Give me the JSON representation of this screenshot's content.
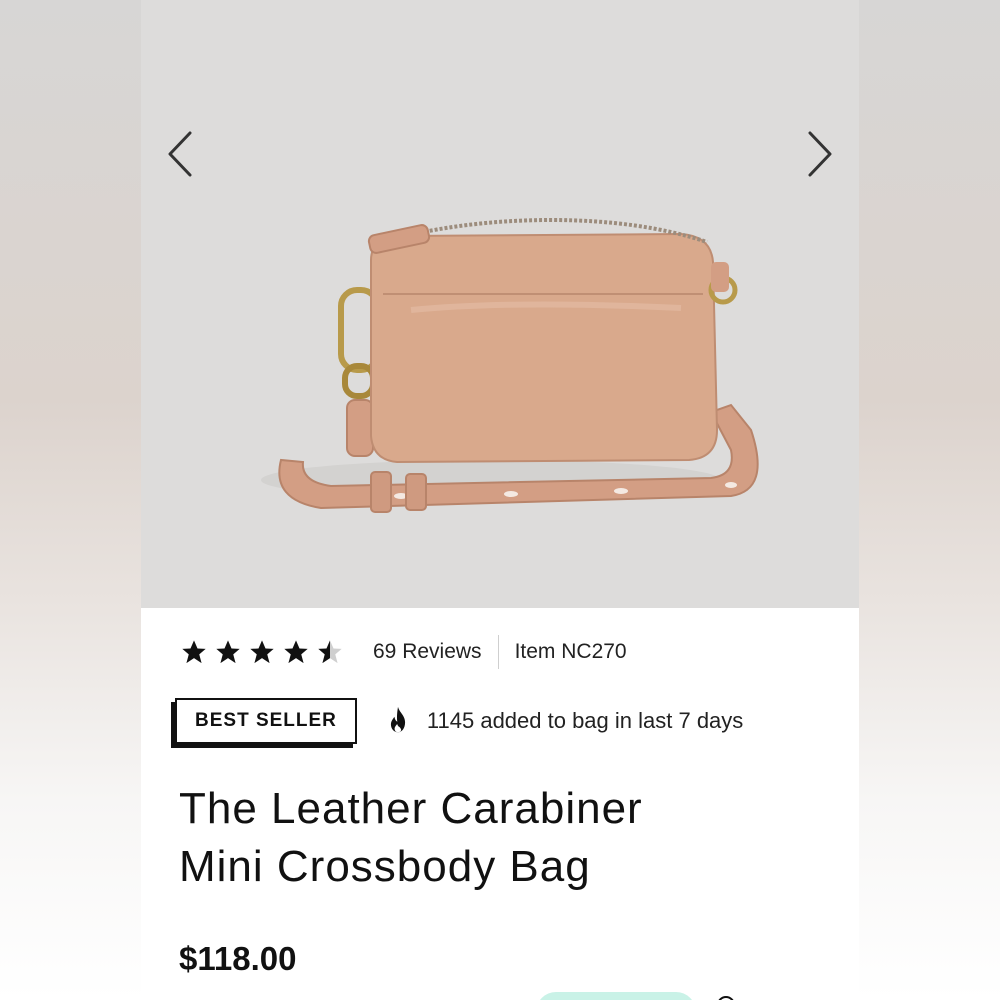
{
  "gallery": {
    "prev_icon": "chevron-left-icon",
    "next_icon": "chevron-right-icon",
    "image_alt": "leather crossbody bag",
    "bag_color": "#d9a98c",
    "hardware_color": "#b89a4a",
    "background_color": "#dddcdb"
  },
  "product": {
    "rating": 4.5,
    "rating_max": 5,
    "reviews_label": "69 Reviews",
    "item_number": "Item NC270",
    "badge": "BEST SELLER",
    "activity_icon": "flame-icon",
    "activity_text": "1145 added to bag in last 7 days",
    "title_line1": "The Leather Carabiner",
    "title_line2": "Mini Crossbody Bag",
    "price": "$118.00"
  },
  "colors": {
    "accent_mint": "#c9f2e7",
    "text": "#111111"
  }
}
